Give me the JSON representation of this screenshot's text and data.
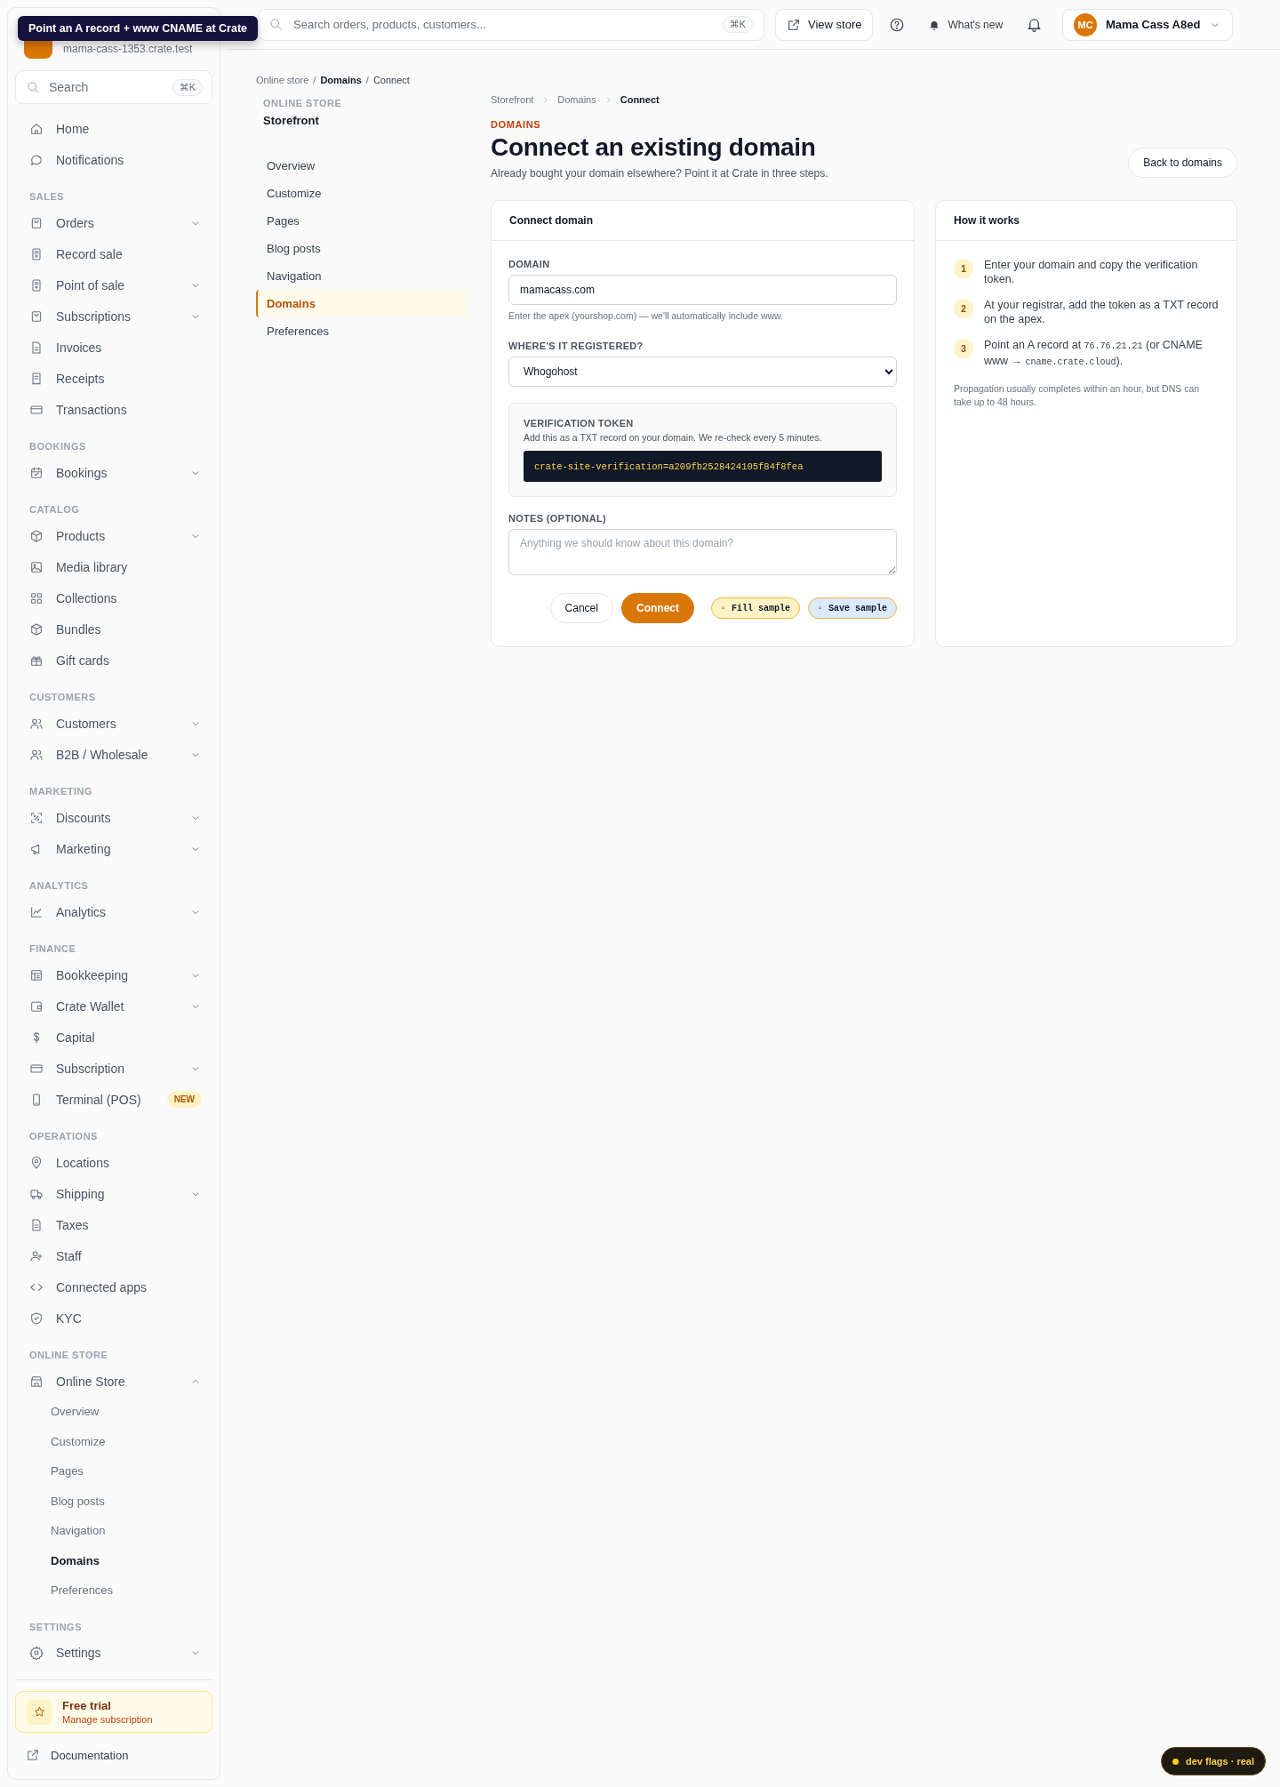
{
  "tooltip": {
    "text": "Point an A record + www CNAME at Crate"
  },
  "sidebar": {
    "store_subdomain": "mama-cass-1353.crate.test",
    "search": {
      "placeholder": "Search",
      "shortcut": "⌘K"
    },
    "top_items": [
      {
        "label": "Home"
      },
      {
        "label": "Notifications"
      }
    ],
    "sections": [
      {
        "title": "SALES",
        "items": [
          {
            "label": "Orders",
            "expandable": true
          },
          {
            "label": "Record sale"
          },
          {
            "label": "Point of sale",
            "expandable": true
          },
          {
            "label": "Subscriptions",
            "expandable": true
          },
          {
            "label": "Invoices"
          },
          {
            "label": "Receipts"
          },
          {
            "label": "Transactions"
          }
        ]
      },
      {
        "title": "BOOKINGS",
        "items": [
          {
            "label": "Bookings",
            "expandable": true
          }
        ]
      },
      {
        "title": "CATALOG",
        "items": [
          {
            "label": "Products",
            "expandable": true
          },
          {
            "label": "Media library"
          },
          {
            "label": "Collections"
          },
          {
            "label": "Bundles"
          },
          {
            "label": "Gift cards"
          }
        ]
      },
      {
        "title": "CUSTOMERS",
        "items": [
          {
            "label": "Customers",
            "expandable": true
          },
          {
            "label": "B2B / Wholesale",
            "expandable": true
          }
        ]
      },
      {
        "title": "MARKETING",
        "items": [
          {
            "label": "Discounts",
            "expandable": true
          },
          {
            "label": "Marketing",
            "expandable": true
          }
        ]
      },
      {
        "title": "ANALYTICS",
        "items": [
          {
            "label": "Analytics",
            "expandable": true
          }
        ]
      },
      {
        "title": "FINANCE",
        "items": [
          {
            "label": "Bookkeeping",
            "expandable": true
          },
          {
            "label": "Crate Wallet",
            "expandable": true
          },
          {
            "label": "Capital"
          },
          {
            "label": "Subscription",
            "expandable": true
          },
          {
            "label": "Terminal (POS)",
            "badge": "NEW"
          }
        ]
      },
      {
        "title": "OPERATIONS",
        "items": [
          {
            "label": "Locations"
          },
          {
            "label": "Shipping",
            "expandable": true
          },
          {
            "label": "Taxes"
          },
          {
            "label": "Staff"
          },
          {
            "label": "Connected apps"
          },
          {
            "label": "KYC"
          }
        ]
      },
      {
        "title": "ONLINE STORE",
        "items": [
          {
            "label": "Online Store",
            "expandable": true,
            "expanded": true,
            "children": [
              {
                "label": "Overview",
                "selected": false
              },
              {
                "label": "Customize",
                "selected": false
              },
              {
                "label": "Pages",
                "selected": false
              },
              {
                "label": "Blog posts",
                "selected": false
              },
              {
                "label": "Navigation",
                "selected": false
              },
              {
                "label": "Domains",
                "selected": true
              },
              {
                "label": "Preferences",
                "selected": false
              }
            ]
          }
        ]
      },
      {
        "title": "SETTINGS",
        "items": [
          {
            "label": "Settings",
            "expandable": true
          }
        ]
      }
    ],
    "trial": {
      "title": "Free trial",
      "subtitle": "Manage subscription"
    },
    "footer_link": "Documentation"
  },
  "topbar": {
    "search": {
      "placeholder": "Search orders, products, customers...",
      "shortcut": "⌘K"
    },
    "view_store": "View store",
    "whats_new": "What's new",
    "user": {
      "initials": "MC",
      "name": "Mama Cass A8ed"
    }
  },
  "breadcrumb": {
    "separator": "/",
    "items": [
      {
        "label": "Online store"
      },
      {
        "label": "Domains"
      },
      {
        "label": "Connect"
      }
    ]
  },
  "secondary_nav": {
    "section": "ONLINE STORE",
    "title": "Storefront",
    "items": [
      {
        "label": "Overview",
        "selected": false
      },
      {
        "label": "Customize",
        "selected": false
      },
      {
        "label": "Pages",
        "selected": false
      },
      {
        "label": "Blog posts",
        "selected": false
      },
      {
        "label": "Navigation",
        "selected": false
      },
      {
        "label": "Domains",
        "selected": true
      },
      {
        "label": "Preferences",
        "selected": false
      }
    ]
  },
  "page": {
    "breadcrumb": [
      {
        "label": "Storefront"
      },
      {
        "label": "Domains"
      },
      {
        "label": "Connect"
      }
    ],
    "eyebrow": "DOMAINS",
    "title": "Connect an existing domain",
    "subtitle": "Already bought your domain elsewhere? Point it at Crate in three steps.",
    "back_button": "Back to domains"
  },
  "form_card": {
    "title": "Connect domain",
    "domain": {
      "label": "DOMAIN",
      "value": "mamacass.com",
      "help": "Enter the apex (yourshop.com) — we'll automatically include www."
    },
    "registrar": {
      "label": "WHERE'S IT REGISTERED?",
      "value": "Whogohost"
    },
    "token": {
      "label": "VERIFICATION TOKEN",
      "description": "Add this as a TXT record on your domain. We re-check every 5 minutes.",
      "value": "crate-site-verification=a209fb2528424105f84f8fea"
    },
    "notes": {
      "label": "NOTES (OPTIONAL)",
      "placeholder": "Anything we should know about this domain?"
    },
    "buttons": [
      {
        "label": "Cancel",
        "kind": "secondary"
      },
      {
        "label": "Connect",
        "kind": "primary"
      },
      {
        "label": "▫ Fill sample",
        "kind": "dev-fill"
      },
      {
        "label": "▫ Save sample",
        "kind": "dev-save"
      }
    ]
  },
  "how_card": {
    "title": "How it works",
    "steps": [
      {
        "number": "1",
        "parts": [
          {
            "kind": "text",
            "text": "Enter your domain and copy the verification token."
          }
        ]
      },
      {
        "number": "2",
        "parts": [
          {
            "kind": "text",
            "text": "At your registrar, add the token as a TXT record on the apex."
          }
        ]
      },
      {
        "number": "3",
        "parts": [
          {
            "kind": "text",
            "text": "Point an A record at "
          },
          {
            "kind": "code",
            "text": "76.76.21.21"
          },
          {
            "kind": "text",
            "text": " (or CNAME www → "
          },
          {
            "kind": "code",
            "text": "cname.crate.cloud"
          },
          {
            "kind": "text",
            "text": ")."
          }
        ]
      }
    ],
    "note": "Propagation usually completes within an hour, but DNS can take up to 48 hours."
  },
  "dev_flags": "dev flags · real"
}
